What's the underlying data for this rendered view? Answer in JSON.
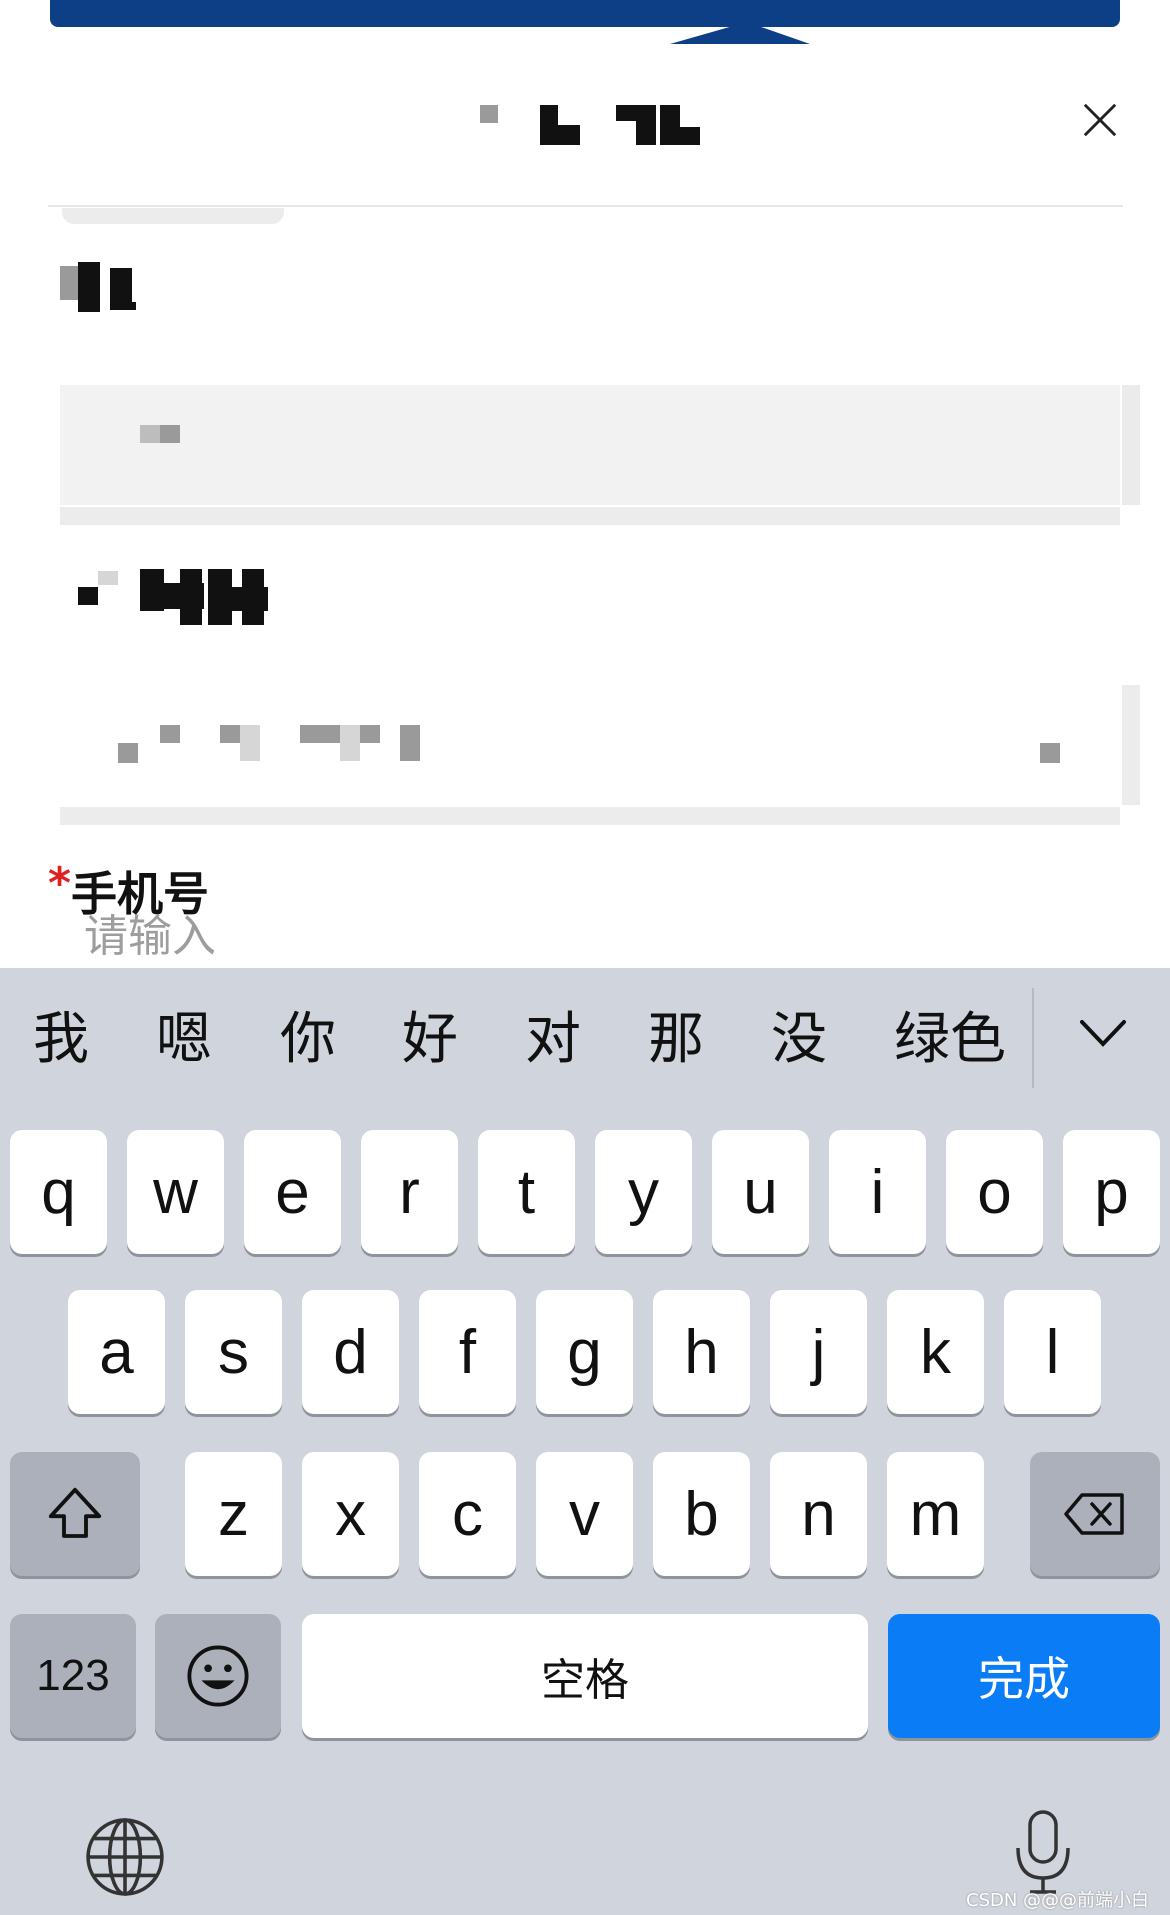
{
  "form": {
    "phone_label": "手机号",
    "required_mark": "*",
    "phone_placeholder": "请输入"
  },
  "keyboard": {
    "candidates": [
      "我",
      "嗯",
      "你",
      "好",
      "对",
      "那",
      "没",
      "绿色"
    ],
    "row1": [
      "q",
      "w",
      "e",
      "r",
      "t",
      "y",
      "u",
      "i",
      "o",
      "p"
    ],
    "row2": [
      "a",
      "s",
      "d",
      "f",
      "g",
      "h",
      "j",
      "k",
      "l"
    ],
    "row3": [
      "z",
      "x",
      "c",
      "v",
      "b",
      "n",
      "m"
    ],
    "numbers_label": "123",
    "space_label": "空格",
    "done_label": "完成"
  },
  "watermark": "CSDN @@@前端小白",
  "colors": {
    "header_blue": "#0c3f86",
    "done_blue": "#0a7cf5",
    "required_red": "#e02020",
    "keyboard_bg": "#d0d4dd"
  },
  "icons": {
    "close": "close-icon",
    "collapse": "chevron-down-icon",
    "shift": "shift-icon",
    "delete": "backspace-icon",
    "emoji": "emoji-icon",
    "globe": "globe-icon",
    "mic": "microphone-icon"
  }
}
